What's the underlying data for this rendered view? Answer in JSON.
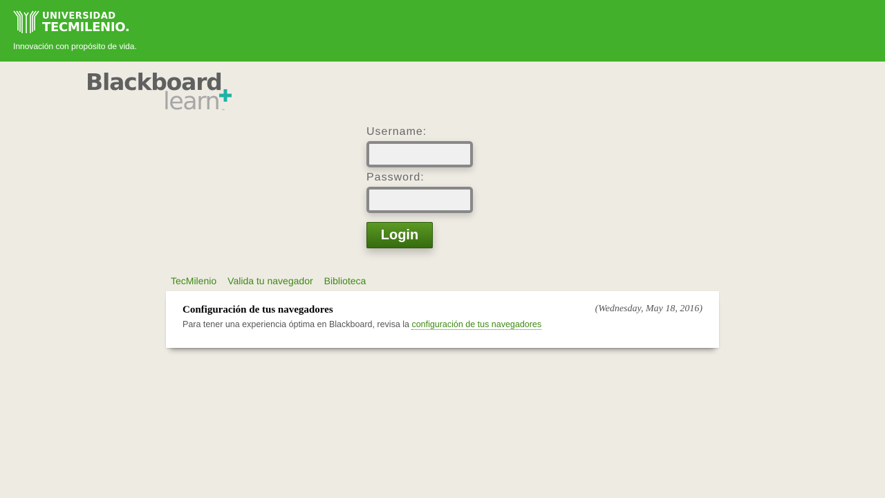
{
  "header": {
    "university_line1": "UNIVERSIDAD",
    "university_line2": "TECMILENIO.",
    "tagline": "Innovación con propósito de vida.",
    "background_color": "#42b02a"
  },
  "brand": {
    "name": "Blackboard",
    "sub": "learn",
    "trademark": "™",
    "plus_color": "#1fb3a6"
  },
  "login": {
    "username_label": "Username:",
    "username_value": "",
    "password_label": "Password:",
    "password_value": "",
    "submit_label": "Login"
  },
  "tabs": [
    {
      "label": "TecMilenio"
    },
    {
      "label": "Valida tu navegador"
    },
    {
      "label": "Biblioteca"
    }
  ],
  "announcement": {
    "title": "Configuración de tus navegadores",
    "date": "(Wednesday, May 18, 2016)",
    "body_prefix": "Para tener una experiencia óptima en Blackboard, revisa la ",
    "link_text": "configuración de tus navegadores"
  }
}
